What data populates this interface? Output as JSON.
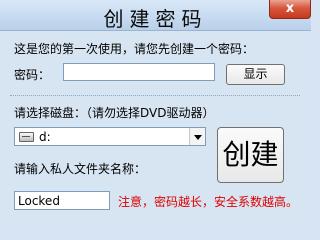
{
  "window": {
    "title": "创建密码",
    "close_label": "x"
  },
  "intro": {
    "text": "这是您的第一次使用，请您先创建一个密码："
  },
  "password": {
    "label": "密码：",
    "value": "",
    "show_button": "显示"
  },
  "disk": {
    "label": "请选择磁盘：（请勿选择DVD驱动器）",
    "selected": "d:",
    "icon": "drive-icon"
  },
  "folder": {
    "label": "请输入私人文件夹名称：",
    "value": "Locked"
  },
  "create_button": "创建",
  "notice": {
    "text": "注意，密码越长，安全系数越高。",
    "color": "#e00000"
  }
}
